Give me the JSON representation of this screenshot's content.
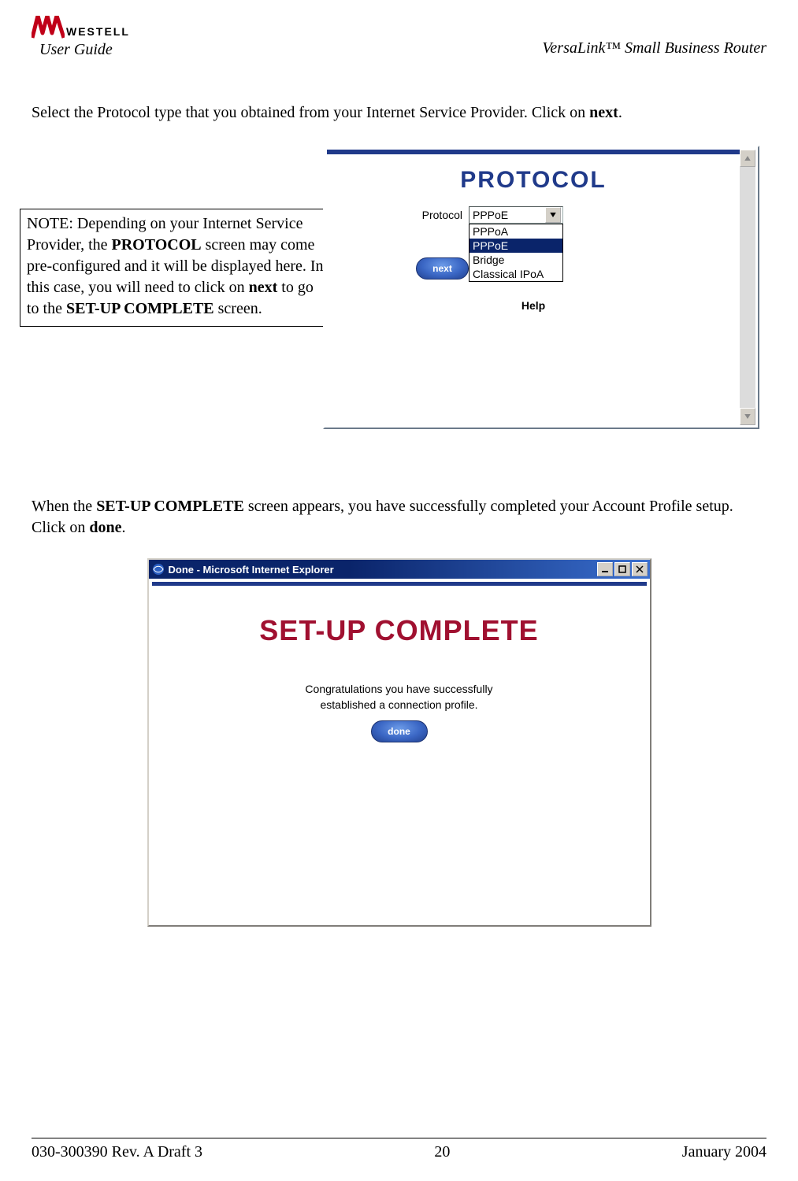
{
  "header": {
    "logo_text": "WESTELL",
    "user_guide": "User Guide",
    "product_name": "VersaLink™  Small Business Router"
  },
  "intro1": {
    "prefix": "Select the Protocol type that you obtained from your Internet Service Provider. Click on ",
    "bold1": "next",
    "suffix": "."
  },
  "note": {
    "t1": "NOTE: Depending on your Internet Service Provider, the ",
    "b1": "PROTOCOL",
    "t2": " screen may come pre-configured and it will be displayed here. In this case, you will need to click on ",
    "b2": "next",
    "t3": " to go to the ",
    "b3": "SET-UP COMPLETE",
    "t4": " screen."
  },
  "protocol_window": {
    "title": "PROTOCOL",
    "label": "Protocol",
    "selected": "PPPoE",
    "options": [
      "PPPoA",
      "PPPoE",
      "Bridge",
      "Classical IPoA"
    ],
    "next_button": "next",
    "help": "Help"
  },
  "intro2": {
    "t1": "When the ",
    "b1": "SET-UP COMPLETE",
    "t2": " screen appears, you have successfully completed your Account Profile setup. Click on ",
    "b2": "done",
    "t3": "."
  },
  "done_window": {
    "titlebar": "Done - Microsoft Internet Explorer",
    "heading": "SET-UP COMPLETE",
    "congrats_line1": "Congratulations you have successfully",
    "congrats_line2": "established a connection profile.",
    "done_button": "done"
  },
  "footer": {
    "left": "030-300390 Rev. A Draft 3",
    "center": "20",
    "right": "January 2004"
  }
}
